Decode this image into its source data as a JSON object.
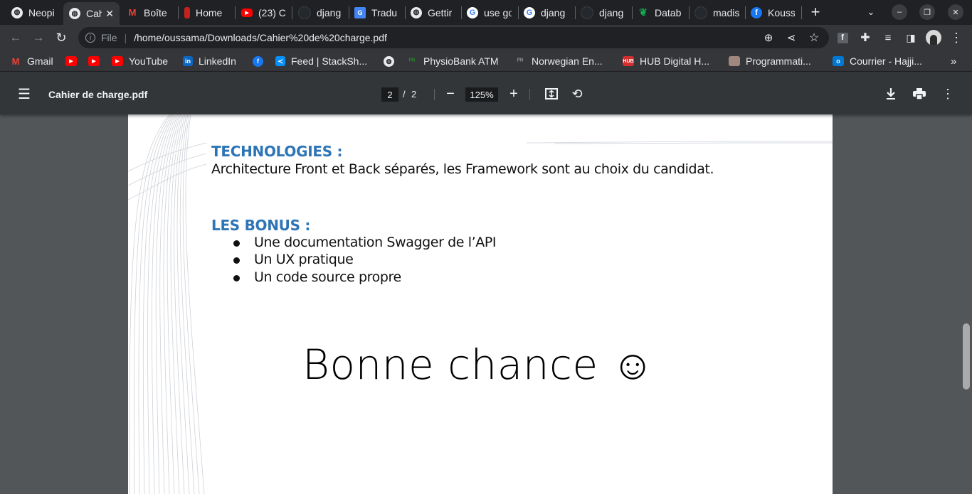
{
  "tabs": [
    {
      "title": "Neopi",
      "icon": "globe-icon",
      "color": "#e8eaed"
    },
    {
      "title": "Cahi",
      "icon": "globe-icon",
      "color": "#e8eaed",
      "active": true
    },
    {
      "title": "Boîte",
      "icon": "gmail-icon",
      "color": "#ea4335"
    },
    {
      "title": "Home",
      "icon": "app-icon",
      "color": "#c5221f"
    },
    {
      "title": "(23) C",
      "icon": "youtube-icon",
      "color": "#ff0000"
    },
    {
      "title": "djang",
      "icon": "github-icon",
      "color": "#24292e"
    },
    {
      "title": "Tradu",
      "icon": "translate-icon",
      "color": "#4285f4"
    },
    {
      "title": "Gettir",
      "icon": "globe-icon",
      "color": "#e8eaed"
    },
    {
      "title": "use go",
      "icon": "google-icon",
      "color": "#ffffff"
    },
    {
      "title": "djang",
      "icon": "google-icon",
      "color": "#ffffff"
    },
    {
      "title": "djang",
      "icon": "github-icon",
      "color": "#24292e"
    },
    {
      "title": "Datab",
      "icon": "mongodb-icon",
      "color": "#13aa52"
    },
    {
      "title": "madis",
      "icon": "github-icon",
      "color": "#24292e"
    },
    {
      "title": "Kouss",
      "icon": "facebook-icon",
      "color": "#1877f2"
    }
  ],
  "toolbar": {
    "scheme": "File",
    "url": "/home/oussama/Downloads/Cahier%20de%20charge.pdf"
  },
  "bookmarks": [
    {
      "label": "Gmail",
      "icon": "gmail-icon",
      "color": "#ea4335"
    },
    {
      "label": "",
      "icon": "youtube-icon",
      "color": "#ff0000"
    },
    {
      "label": "",
      "icon": "youtube-icon",
      "color": "#ff0000"
    },
    {
      "label": "YouTube",
      "icon": "youtube-icon",
      "color": "#ff0000"
    },
    {
      "label": "LinkedIn",
      "icon": "linkedin-icon",
      "color": "#0a66c2"
    },
    {
      "label": "",
      "icon": "facebook-icon",
      "color": "#1877f2"
    },
    {
      "label": "Feed | StackSh...",
      "icon": "stackshare-icon",
      "color": "#0690fa"
    },
    {
      "label": "",
      "icon": "globe-icon",
      "color": "#e8eaed"
    },
    {
      "label": "PhysioBank ATM",
      "icon": "physionet-icon",
      "color": "#2e7d32"
    },
    {
      "label": "Norwegian En...",
      "icon": "physionet-icon",
      "color": "#3c3c3c"
    },
    {
      "label": "HUB Digital H...",
      "icon": "hub-icon",
      "color": "#d32f2f"
    },
    {
      "label": "Programmati...",
      "icon": "image-icon",
      "color": "#a1887f"
    },
    {
      "label": "Courrier - Hajji...",
      "icon": "outlook-icon",
      "color": "#0078d4"
    }
  ],
  "pdf": {
    "title": "Cahier de charge.pdf",
    "current_page": "2",
    "separator": "/",
    "total_pages": "2",
    "zoom": "125%"
  },
  "document": {
    "technologies_heading": "TECHNOLOGIES :",
    "technologies_text": "Architecture Front et Back séparés, les Framework sont au choix du candidat.",
    "bonus_heading": "LES BONUS :",
    "bonus_items": [
      "Une documentation Swagger de l’API",
      "Un UX pratique",
      "Un code source propre"
    ],
    "closing": "Bonne chance ☺"
  }
}
